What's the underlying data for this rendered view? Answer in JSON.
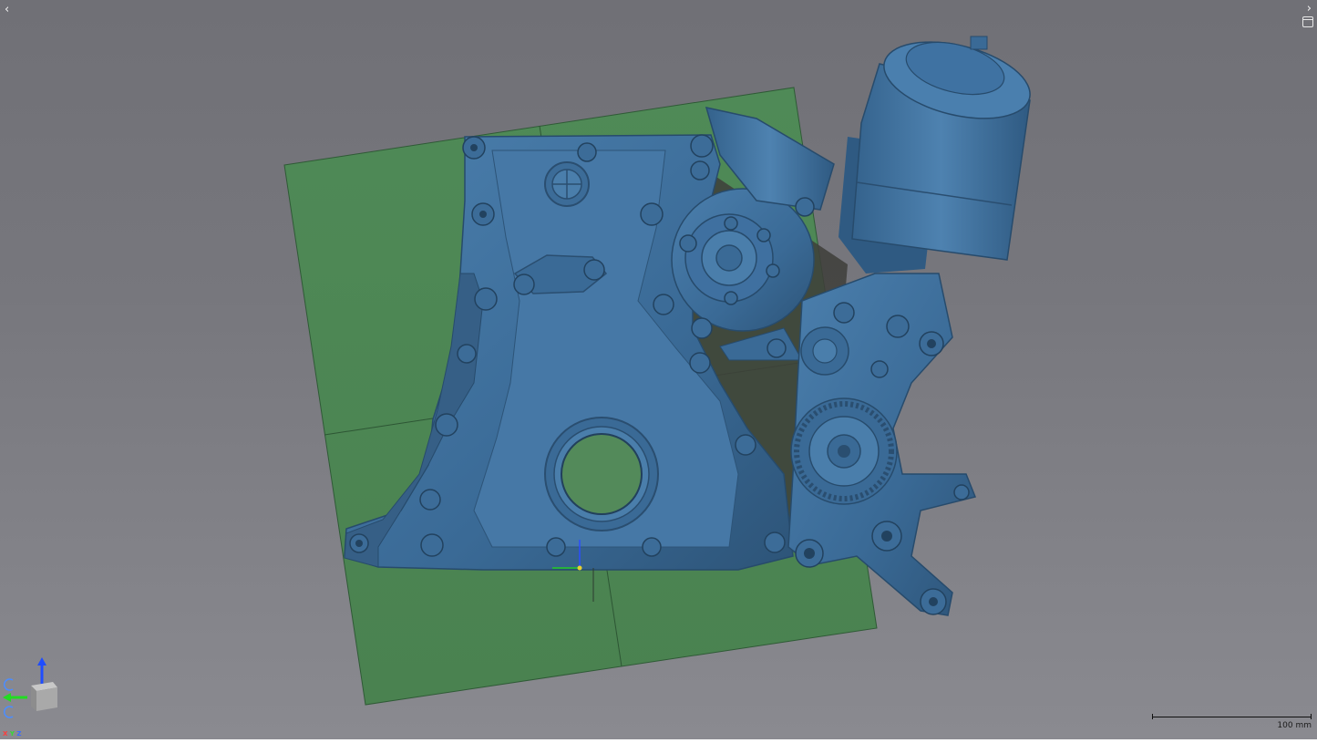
{
  "viewport": {
    "background_top": "#707076",
    "background_bottom": "#8a8a90"
  },
  "controls": {
    "collapse_left_icon": "chevron-left-icon",
    "collapse_right_icon": "chevron-right-icon",
    "panel_icon": "panel-toggle-icon"
  },
  "scale_bar": {
    "label": "100 mm"
  },
  "axis_widget": {
    "letters": [
      "X",
      "Y",
      "Z"
    ],
    "colors": {
      "x": "#ff3b3b",
      "y": "#33dd33",
      "z": "#3b6bff"
    }
  },
  "model": {
    "name_icon": "engine-timing-cover-mesh",
    "color": "#3f6f99",
    "ground_plane_color": "#538a5a"
  }
}
